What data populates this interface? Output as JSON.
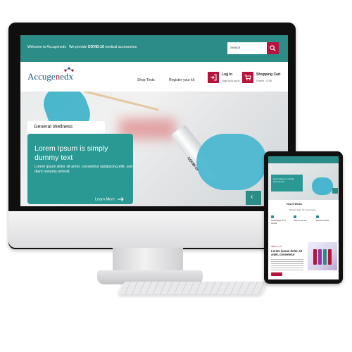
{
  "site": {
    "welcome": "Welcome to Accugenedx",
    "tagline_prefix": "We provide",
    "tagline_bold": "COVID-19",
    "tagline_suffix": "medical accessories",
    "search_placeholder": "Search",
    "brand_left": "Accuge",
    "brand_mid": "n",
    "brand_right": "edx",
    "nav": [
      "Shop Tests",
      "Register your kit"
    ],
    "login_label": "Log In",
    "login_sub": "Sign up/Log in",
    "cart_label": "Shopping Cart",
    "cart_sub": "0 item - 0.00",
    "hero_tag": "General Wellness",
    "hero_heading": "Lorem Ipsum is simply dummy text",
    "hero_body": "Lorem ipsum dolor sit amet, consetetur sadipscing elitr, sed diam nonumy eirmod",
    "hero_cta": "Learn More",
    "hero_prev_icon": "chevron-left-icon",
    "swab_label": "COVID-19"
  },
  "tablet": {
    "heading": "How It Works",
    "subheading": "Simple steps for our process",
    "subtitle": "ABOUT US",
    "features": [
      "Consultation from trusted",
      "Select your test",
      "Receive results"
    ],
    "content_heading": "Lorem ipsum dolor sit amet, consetetur"
  },
  "colors": {
    "teal": "#2c8c88",
    "crimson": "#b6143c",
    "navy": "#1b5b78"
  }
}
